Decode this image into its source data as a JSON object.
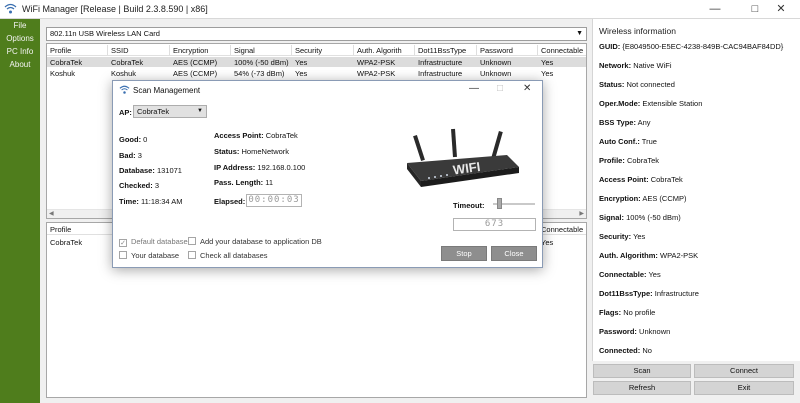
{
  "window": {
    "title": "WiFi Manager [Release | Build 2.3.8.590 | x86]"
  },
  "menu": [
    "File",
    "Options",
    "PC Info",
    "About"
  ],
  "adapter": {
    "selected": "802.11n USB Wireless LAN Card"
  },
  "columns": [
    "Profile",
    "SSID",
    "Encryption",
    "Signal",
    "Security",
    "Auth. Algorith",
    "Dot11BssType",
    "Password",
    "Connectable"
  ],
  "networks": [
    [
      "CobraTek",
      "CobraTek",
      "AES (CCMP)",
      "100% (-50 dBm)",
      "Yes",
      "WPA2-PSK",
      "Infrastructure",
      "Unknown",
      "Yes"
    ],
    [
      "Koshuk",
      "Koshuk",
      "AES (CCMP)",
      "54% (-73 dBm)",
      "Yes",
      "WPA2-PSK",
      "Infrastructure",
      "Unknown",
      "Yes"
    ]
  ],
  "bottom_columns": [
    "Profile",
    "",
    "",
    "",
    "",
    "",
    "",
    "",
    "Connectable"
  ],
  "bottom_rows": [
    [
      "CobraTek",
      "",
      "",
      "",
      "",
      "",
      "",
      "",
      "Yes"
    ]
  ],
  "info": {
    "heading": "Wireless information",
    "items": [
      {
        "k": "GUID:",
        "v": "{E8049500-E5EC-4238-849B-CAC94BAF84DD}"
      },
      {
        "k": "Network:",
        "v": "Native WiFi"
      },
      {
        "k": "Status:",
        "v": "Not connected"
      },
      {
        "k": "Oper.Mode:",
        "v": "Extensible Station"
      },
      {
        "k": "BSS Type:",
        "v": "Any"
      },
      {
        "k": "Auto Conf.:",
        "v": "True"
      },
      {
        "k": "Profile:",
        "v": "CobraTek"
      },
      {
        "k": "Access Point:",
        "v": "CobraTek"
      },
      {
        "k": "Encryption:",
        "v": "AES (CCMP)"
      },
      {
        "k": "Signal:",
        "v": "100% (-50 dBm)"
      },
      {
        "k": "Security:",
        "v": "Yes"
      },
      {
        "k": "Auth. Algorithm:",
        "v": "WPA2-PSK"
      },
      {
        "k": "Connectable:",
        "v": "Yes"
      },
      {
        "k": "Dot11BssType:",
        "v": "Infrastructure"
      },
      {
        "k": "Flags:",
        "v": "No profile"
      },
      {
        "k": "Password:",
        "v": "Unknown"
      },
      {
        "k": "Connected:",
        "v": "No"
      }
    ]
  },
  "buttons": {
    "scan": "Scan",
    "connect": "Connect",
    "refresh": "Refresh",
    "exit": "Exit"
  },
  "dialog": {
    "title": "Scan Management",
    "ap_label": "AP:",
    "ap_value": "CobraTek",
    "good_label": "Good:",
    "good": "0",
    "bad_label": "Bad:",
    "bad": "3",
    "database_label": "Database:",
    "database": "131071",
    "checked_label": "Checked:",
    "checked": "3",
    "time_label": "Time:",
    "time": "11:18:34 AM",
    "access_point_label": "Access Point:",
    "access_point": "CobraTek",
    "status_label": "Status:",
    "status": "HomeNetwork",
    "ip_label": "IP Address:",
    "ip": "192.168.0.100",
    "pass_label": "Pass. Length:",
    "pass_length": "11",
    "elapsed_label": "Elapsed:",
    "elapsed": "00:00:03",
    "timeout_label": "Timeout:",
    "timeout_value": "673",
    "router_text": "WIFI",
    "checks": {
      "default_db": "Default database",
      "add_db": "Add your database to application DB",
      "your_db": "Your database",
      "check_all": "Check all databases"
    },
    "stop": "Stop",
    "close": "Close"
  },
  "colors": {
    "sidebar": "#4f7d1c",
    "selection": "#dcdcdc",
    "button": "#8e8e8e"
  }
}
